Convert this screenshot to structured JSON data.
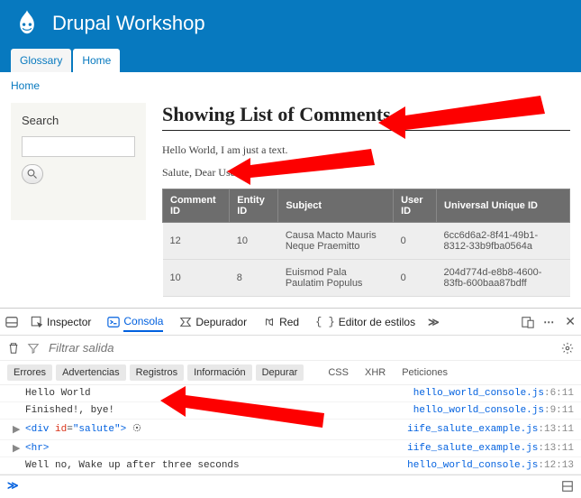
{
  "header": {
    "title": "Drupal Workshop"
  },
  "tabs": {
    "items": [
      "Glossary",
      "Home"
    ],
    "active": 1
  },
  "breadcrumb": {
    "home": "Home"
  },
  "sidebar": {
    "search_heading": "Search"
  },
  "main": {
    "title": "Showing List of Comments",
    "line1": "Hello World, I am just a text.",
    "line2": "Salute, Dear User"
  },
  "table": {
    "cols": [
      "Comment ID",
      "Entity ID",
      "Subject",
      "User ID",
      "Universal Unique ID"
    ],
    "rows": [
      {
        "cid": "12",
        "eid": "10",
        "subject": "Causa Macto Mauris Neque Praemitto",
        "uid": "0",
        "uuid": "6cc6d6a2-8f41-49b1-8312-33b9fba0564a"
      },
      {
        "cid": "10",
        "eid": "8",
        "subject": "Euismod Pala Paulatim Populus",
        "uid": "0",
        "uuid": "204d774d-e8b8-4600-83fb-600baa87bdff"
      }
    ]
  },
  "devtools": {
    "tabs": {
      "inspector": "Inspector",
      "console": "Consola",
      "debugger": "Depurador",
      "net": "Red",
      "styles": "Editor de estilos"
    },
    "filter_placeholder": "Filtrar salida",
    "filters": {
      "errors": "Errores",
      "warnings": "Advertencias",
      "logs": "Registros",
      "info": "Información",
      "debug": "Depurar",
      "css": "CSS",
      "xhr": "XHR",
      "requests": "Peticiones"
    },
    "logs": [
      {
        "msg": "Hello World",
        "src": "hello_world_console.js:6:11",
        "k": "text"
      },
      {
        "msg": "Finished!, bye!",
        "src": "hello_world_console.js:9:11",
        "k": "text"
      },
      {
        "html": "<div id=\"salute\">",
        "src": "iife_salute_example.js:13:11",
        "k": "node",
        "gear": true
      },
      {
        "html": "<hr>",
        "src": "iife_salute_example.js:13:11",
        "k": "node"
      },
      {
        "msg": "Well no, Wake up after three seconds",
        "src": "hello_world_console.js:12:13",
        "k": "text"
      }
    ],
    "prompt": "≫"
  }
}
